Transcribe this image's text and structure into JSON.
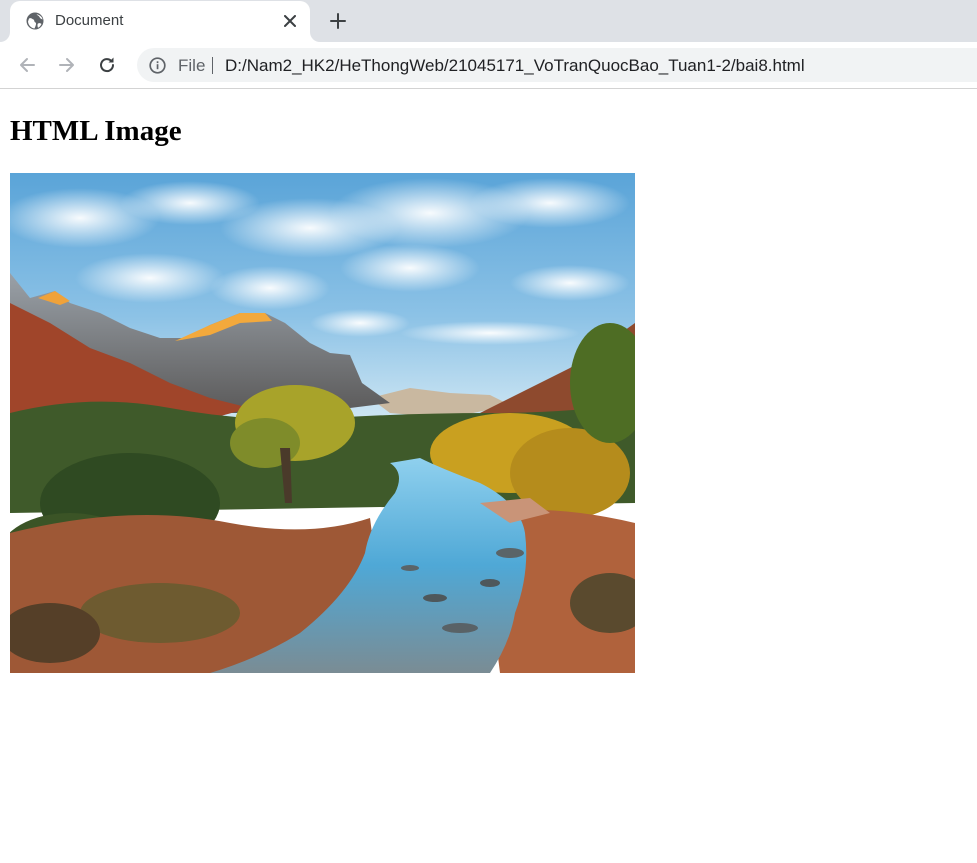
{
  "browser": {
    "tab": {
      "title": "Document",
      "favicon": "globe-icon",
      "close_icon": "close-icon"
    },
    "new_tab_icon": "plus-icon",
    "nav": {
      "back_icon": "arrow-left-icon",
      "forward_icon": "arrow-right-icon",
      "reload_icon": "reload-icon"
    },
    "address_bar": {
      "security_icon": "info-icon",
      "scheme_label": "File",
      "url": "D:/Nam2_HK2/HeThongWeb/21045171_VoTranQuocBao_Tuan1-2/bai8.html"
    }
  },
  "page": {
    "heading": "HTML Image"
  }
}
